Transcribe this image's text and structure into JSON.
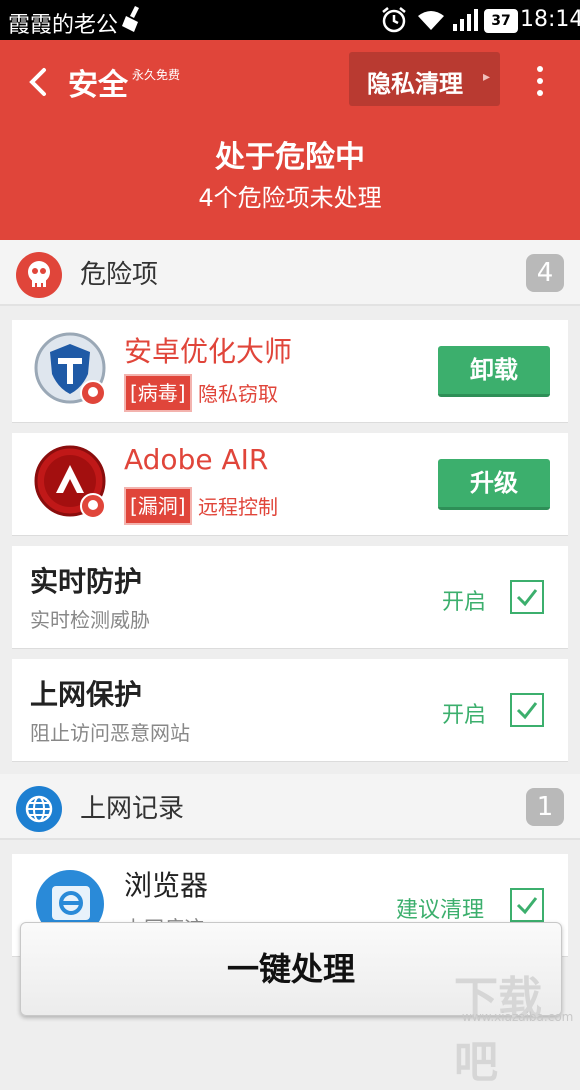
{
  "statusbar": {
    "carrier": "霞霞的老公",
    "battery": "37",
    "time": "18:14"
  },
  "header": {
    "title": "安全",
    "subtitle": "永久免费",
    "privacy_button": "隐私清理",
    "status": "处于危险中",
    "pending": "4个危险项未处理"
  },
  "danger_section": {
    "title": "危险项",
    "count": "4",
    "apps": [
      {
        "name": "安卓优化大师",
        "tag": "[病毒]",
        "risk": "隐私窃取",
        "action": "卸载"
      },
      {
        "name": "Adobe AIR",
        "tag": "[漏洞]",
        "risk": "远程控制",
        "action": "升级"
      }
    ],
    "protections": [
      {
        "title": "实时防护",
        "desc": "实时检测威胁",
        "state": "开启"
      },
      {
        "title": "上网保护",
        "desc": "阻止访问恶意网站",
        "state": "开启"
      }
    ]
  },
  "web_section": {
    "title": "上网记录",
    "count": "1",
    "items": [
      {
        "title": "浏览器",
        "desc": "上网痕迹",
        "state": "建议清理"
      }
    ]
  },
  "bottom_button": "一键处理",
  "watermark": {
    "big": "下载吧",
    "small": "www.xiazaiba.com"
  },
  "colors": {
    "header_red": "#e0453a",
    "action_green": "#3caf6d",
    "web_blue": "#1d7fd1"
  }
}
